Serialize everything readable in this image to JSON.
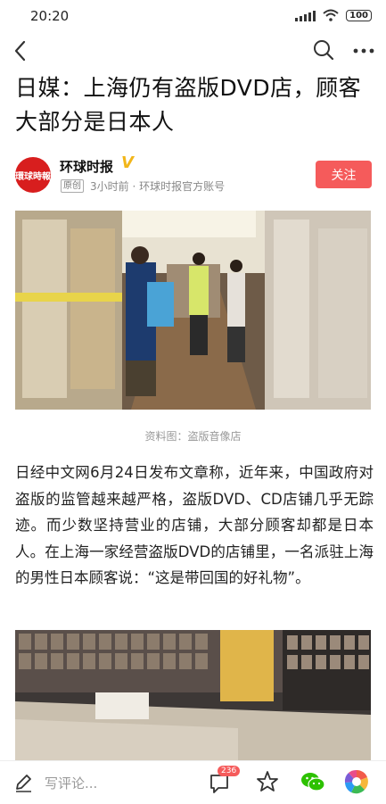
{
  "status_bar": {
    "time": "20:20",
    "battery": "100"
  },
  "nav": {
    "back_icon": "back-arrow-icon",
    "search_icon": "search-icon",
    "more_icon": "more-dots-icon"
  },
  "article": {
    "title": "日媒：上海仍有盗版DVD店，顾客大部分是日本人",
    "author": {
      "name": "环球时报",
      "verified_badge": "V",
      "avatar_text": "環球時報",
      "original_tag": "原创",
      "meta": "3小时前 · 环球时报官方账号",
      "follow_label": "关注"
    },
    "image_caption": "资料图：盗版音像店",
    "paragraph": "日经中文网6月24日发布文章称，近年来，中国政府对盗版的监管越来越严格，盗版DVD、CD店铺几乎无踪迹。而少数坚持营业的店铺，大部分顾客却都是日本人。在上海一家经营盗版DVD的店铺里，一名派驻上海的男性日本顾客说：“这是带回国的好礼物”。"
  },
  "bottom_bar": {
    "comment_placeholder": "写评论...",
    "comment_count": "236",
    "icons": [
      "pen-icon",
      "comment-icon",
      "star-icon",
      "wechat-icon",
      "moments-icon"
    ]
  },
  "colors": {
    "accent": "#f55b5b",
    "verified": "#f2b61a",
    "avatar": "#d81e1e"
  }
}
